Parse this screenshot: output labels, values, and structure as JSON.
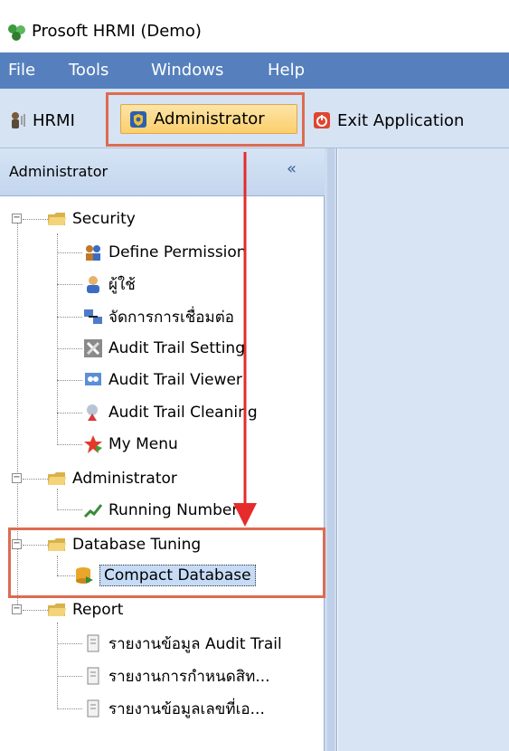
{
  "window": {
    "title": "Prosoft HRMI (Demo)"
  },
  "menu": [
    "File",
    "Tools",
    "Windows",
    "Help"
  ],
  "toolbar": {
    "hrmi": "HRMI",
    "administrator": "Administrator",
    "exit": "Exit Application"
  },
  "panel": {
    "title": "Administrator",
    "collapse_glyph": "«"
  },
  "tree": {
    "security": {
      "label": "Security",
      "items": [
        "Define Permission",
        "ผู้ใช้",
        "จัดการการเชื่อมต่อ",
        "Audit Trail Setting",
        "Audit Trail Viewer",
        "Audit Trail Cleaning",
        "My Menu"
      ]
    },
    "administrator": {
      "label": "Administrator",
      "items": [
        "Running Number"
      ]
    },
    "database_tuning": {
      "label": "Database Tuning",
      "items": [
        "Compact Database"
      ]
    },
    "report": {
      "label": "Report",
      "items": [
        "รายงานข้อมูล Audit Trail",
        "รายงานการกำหนดสิท...",
        "รายงานข้อมูลเลขที่เอ..."
      ]
    }
  },
  "colors": {
    "menubar": "#5680bd",
    "toolbar": "#d6e3f3",
    "highlight": "#de6b51",
    "arrow": "#e52b2b"
  }
}
